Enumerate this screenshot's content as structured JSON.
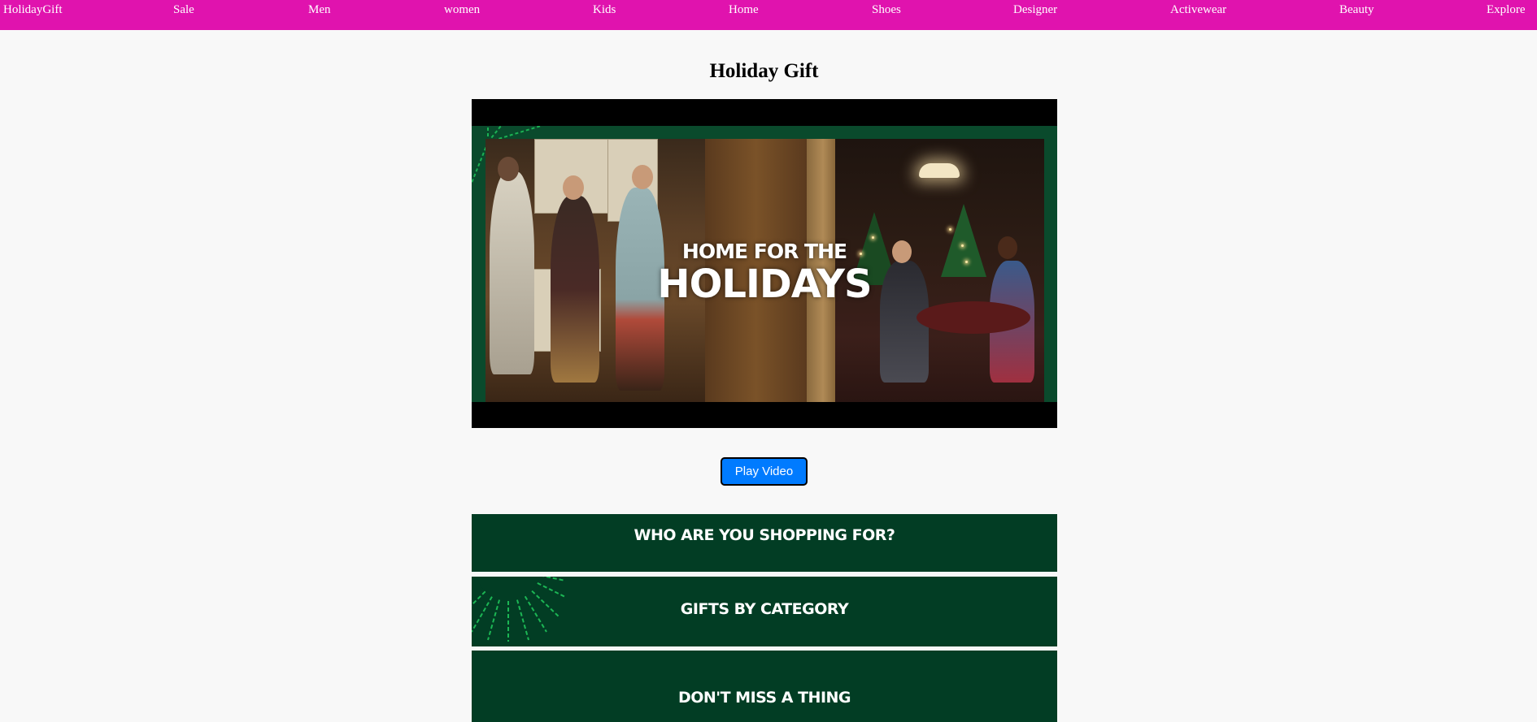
{
  "nav": {
    "items": [
      "HolidayGift",
      "Sale",
      "Men",
      "women",
      "Kids",
      "Home",
      "Shoes",
      "Designer",
      "Activewear",
      "Beauty",
      "Explore"
    ],
    "background": "#e013ae",
    "text_color": "#ffffff"
  },
  "page": {
    "title": "Holiday Gift",
    "background": "#f8f8f8"
  },
  "video": {
    "overlay_line1": "HOME FOR THE",
    "overlay_line2": "HOLIDAYS",
    "frame_color": "#000000",
    "border_color": "#0a4a2c"
  },
  "play_button": {
    "label": "Play Video",
    "color": "#007bff"
  },
  "banners": [
    {
      "label": "WHO ARE YOU SHOPPING FOR?"
    },
    {
      "label": "GIFTS BY CATEGORY"
    },
    {
      "label": "DON'T MISS A THING"
    }
  ],
  "banner_color": "#023d24",
  "accent_green": "#1fc45a"
}
